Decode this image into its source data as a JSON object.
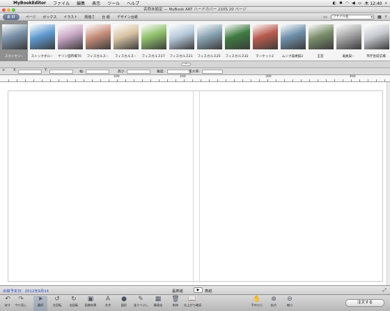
{
  "menubar": {
    "app": "MyBookEditor",
    "items": [
      "ファイル",
      "編集",
      "表示",
      "ツール",
      "ヘルプ"
    ],
    "clock": "木 12:40"
  },
  "window": {
    "title": "名称未設定 — MyBook ART ハードカバー 210S 20 ページ"
  },
  "tabs": {
    "items": [
      "素 材",
      "ページ",
      "ボックス",
      "イラスト",
      "题値さ",
      "台 紙",
      "デザイン台紙"
    ],
    "sort_label": "ファイル名"
  },
  "thumbnails": [
    {
      "caption": "スカンセン--",
      "color": "#7a91a8"
    },
    {
      "caption": "ストックホル--",
      "color": "#5f9ad0"
    },
    {
      "caption": "ケリン田市場70",
      "color": "#c9a7c5"
    },
    {
      "caption": "フィスカルス--",
      "color": "#c98f7c"
    },
    {
      "caption": "フィスカルス--",
      "color": "#d8c3a3"
    },
    {
      "caption": "フィスカルス17",
      "color": "#8fbf6a"
    },
    {
      "caption": "フィスカルス21",
      "color": "#b6c9d9"
    },
    {
      "caption": "フィスカルス25",
      "color": "#8aa4b3"
    },
    {
      "caption": "フィスカルス32",
      "color": "#3f7b42"
    },
    {
      "caption": "マーケット2",
      "color": "#b95b4e"
    },
    {
      "caption": "ムンク美術館2",
      "color": "#6f8fa9"
    },
    {
      "caption": "王宮",
      "color": "#7d8f6e"
    },
    {
      "caption": "竜員安--",
      "color": "#a7a7a7"
    },
    {
      "caption": "市庁舎前広場",
      "color": "#c5c9cf"
    }
  ],
  "inspector": {
    "x_label": "X:",
    "y_label": "Y:",
    "w_label": "幅:",
    "h_label": "高さ:",
    "angle_label": "角度:",
    "zoom_label": "拡大率:"
  },
  "ruler": {
    "marks": [
      "100",
      "200",
      "300",
      "400"
    ]
  },
  "status": {
    "date": "出荷予定日：2012年9月14",
    "back_cover": "裏表紙",
    "front_cover": "表紙",
    "flip_icon": "▶"
  },
  "toolbar": {
    "tools": [
      {
        "label": "戻す",
        "icon": "undo-icon",
        "glyph": "↶"
      },
      {
        "label": "やり直し",
        "icon": "redo-icon",
        "glyph": "↷"
      },
      {
        "label": "選択",
        "icon": "pointer-icon",
        "glyph": "➤"
      },
      {
        "label": "左回転",
        "icon": "rotate-left-icon",
        "glyph": "↺"
      },
      {
        "label": "右回転",
        "icon": "rotate-right-icon",
        "glyph": "↻"
      },
      {
        "label": "画像効果",
        "icon": "image-effect-icon",
        "glyph": "▣"
      },
      {
        "label": "文字",
        "icon": "text-icon",
        "glyph": "A"
      },
      {
        "label": "図形",
        "icon": "shape-icon",
        "glyph": "●"
      },
      {
        "label": "塗りつぶし",
        "icon": "fill-icon",
        "glyph": "✎"
      },
      {
        "label": "最適化",
        "icon": "optimize-icon",
        "glyph": "▦"
      },
      {
        "label": "削除",
        "icon": "trash-icon",
        "glyph": "🗑"
      },
      {
        "label": "仕上がり確認",
        "icon": "preview-book-icon",
        "glyph": "📖"
      }
    ],
    "right_tools": [
      {
        "label": "手のひら",
        "icon": "hand-icon",
        "glyph": "✋"
      },
      {
        "label": "拡大",
        "icon": "zoom-in-icon",
        "glyph": "⊕"
      },
      {
        "label": "縮小",
        "icon": "zoom-out-icon",
        "glyph": "⊖"
      }
    ],
    "complete_label": "注文する"
  },
  "colors": {
    "accent": "#5d6f8b",
    "date_text": "#2a43c8",
    "toolbar_bg": "#c7c7c7"
  }
}
